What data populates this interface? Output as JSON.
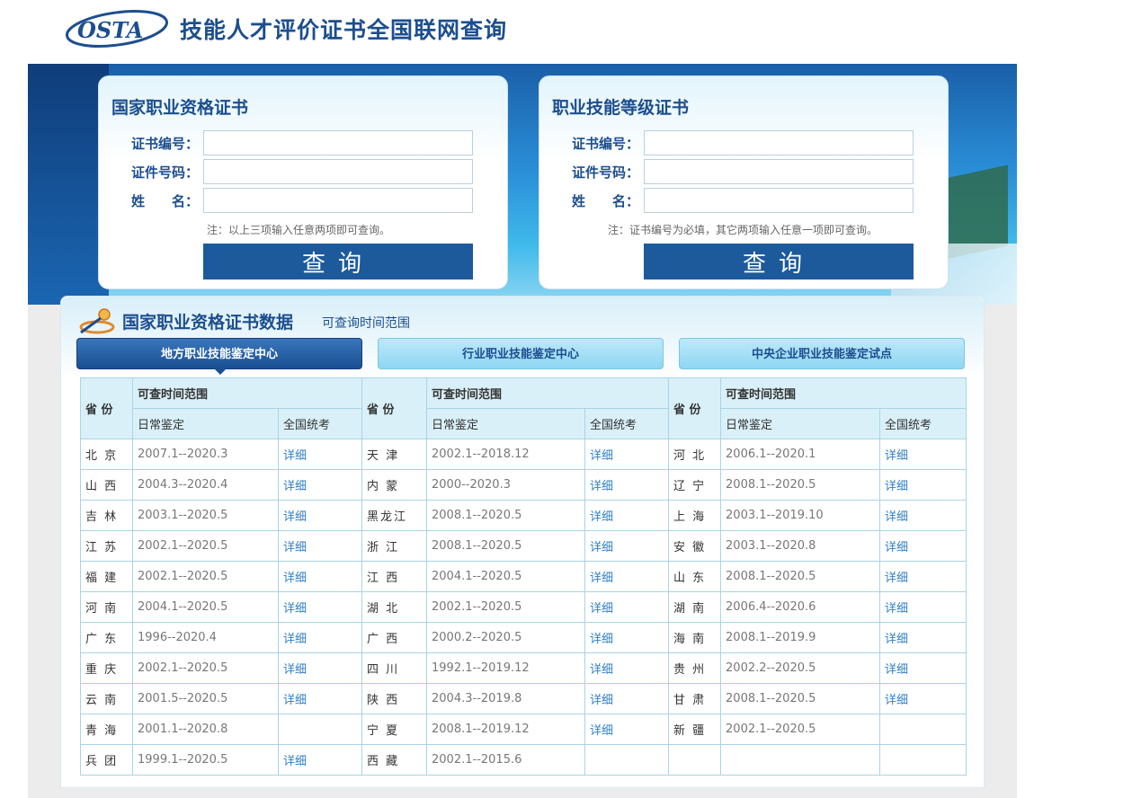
{
  "header": {
    "logo_text": "OSTA",
    "site_title": "技能人才评价证书全国联网查询"
  },
  "panels": [
    {
      "title": "国家职业资格证书",
      "fields": [
        {
          "label": "证书编号：",
          "value": "",
          "placeholder": ""
        },
        {
          "label": "证件号码：",
          "value": "",
          "placeholder": ""
        },
        {
          "label": "姓　　名：",
          "value": "",
          "placeholder": ""
        }
      ],
      "note": "注：以上三项输入任意两项即可查询。",
      "button": "查询"
    },
    {
      "title": "职业技能等级证书",
      "fields": [
        {
          "label": "证书编号：",
          "value": "",
          "placeholder": ""
        },
        {
          "label": "证件号码：",
          "value": "",
          "placeholder": ""
        },
        {
          "label": "姓　　名：",
          "value": "",
          "placeholder": ""
        }
      ],
      "note": "注：证书编号为必填，其它两项输入任意一项即可查询。",
      "button": "查询"
    }
  ],
  "data_section": {
    "title": "国家职业资格证书数据",
    "subtitle": "可查询时间范围",
    "tabs": [
      "地方职业技能鉴定中心",
      "行业职业技能鉴定中心",
      "中央企业职业技能鉴定试点"
    ],
    "active_tab": 0,
    "table_headers": {
      "province": "省 份",
      "range": "可查时间范围",
      "daily": "日常鉴定",
      "national": "全国统考"
    },
    "rows": [
      [
        [
          "北 京",
          "2007.1--2020.3",
          "详细"
        ],
        [
          "天 津",
          "2002.1--2018.12",
          "详细"
        ],
        [
          "河 北",
          "2006.1--2020.1",
          "详细"
        ]
      ],
      [
        [
          "山 西",
          "2004.3--2020.4",
          "详细"
        ],
        [
          "内 蒙",
          "2000--2020.3",
          "详细"
        ],
        [
          "辽 宁",
          "2008.1--2020.5",
          "详细"
        ]
      ],
      [
        [
          "吉 林",
          "2003.1--2020.5",
          "详细"
        ],
        [
          "黑龙江",
          "2008.1--2020.5",
          "详细"
        ],
        [
          "上 海",
          "2003.1--2019.10",
          "详细"
        ]
      ],
      [
        [
          "江 苏",
          "2002.1--2020.5",
          "详细"
        ],
        [
          "浙 江",
          "2008.1--2020.5",
          "详细"
        ],
        [
          "安 徽",
          "2003.1--2020.8",
          "详细"
        ]
      ],
      [
        [
          "福 建",
          "2002.1--2020.5",
          "详细"
        ],
        [
          "江 西",
          "2004.1--2020.5",
          "详细"
        ],
        [
          "山 东",
          "2008.1--2020.5",
          "详细"
        ]
      ],
      [
        [
          "河 南",
          "2004.1--2020.5",
          "详细"
        ],
        [
          "湖 北",
          "2002.1--2020.5",
          "详细"
        ],
        [
          "湖 南",
          "2006.4--2020.6",
          "详细"
        ]
      ],
      [
        [
          "广 东",
          "1996--2020.4",
          "详细"
        ],
        [
          "广 西",
          "2000.2--2020.5",
          "详细"
        ],
        [
          "海 南",
          "2008.1--2019.9",
          "详细"
        ]
      ],
      [
        [
          "重 庆",
          "2002.1--2020.5",
          "详细"
        ],
        [
          "四 川",
          "1992.1--2019.12",
          "详细"
        ],
        [
          "贵 州",
          "2002.2--2020.5",
          "详细"
        ]
      ],
      [
        [
          "云 南",
          "2001.5--2020.5",
          "详细"
        ],
        [
          "陕 西",
          "2004.3--2019.8",
          "详细"
        ],
        [
          "甘 肃",
          "2008.1--2020.5",
          "详细"
        ]
      ],
      [
        [
          "青 海",
          "2001.1--2020.8",
          ""
        ],
        [
          "宁 夏",
          "2008.1--2019.12",
          "详细"
        ],
        [
          "新 疆",
          "2002.1--2020.5",
          ""
        ]
      ],
      [
        [
          "兵 团",
          "1999.1--2020.5",
          "详细"
        ],
        [
          "西 藏",
          "2002.1--2015.6",
          ""
        ],
        [
          "",
          "",
          ""
        ]
      ]
    ]
  },
  "colors": {
    "brand": "#1c4e8e",
    "button": "#1c5a9c",
    "link": "#2f7fc5",
    "table_border": "#a8d4e6",
    "table_header_bg": "#daf0f8"
  }
}
